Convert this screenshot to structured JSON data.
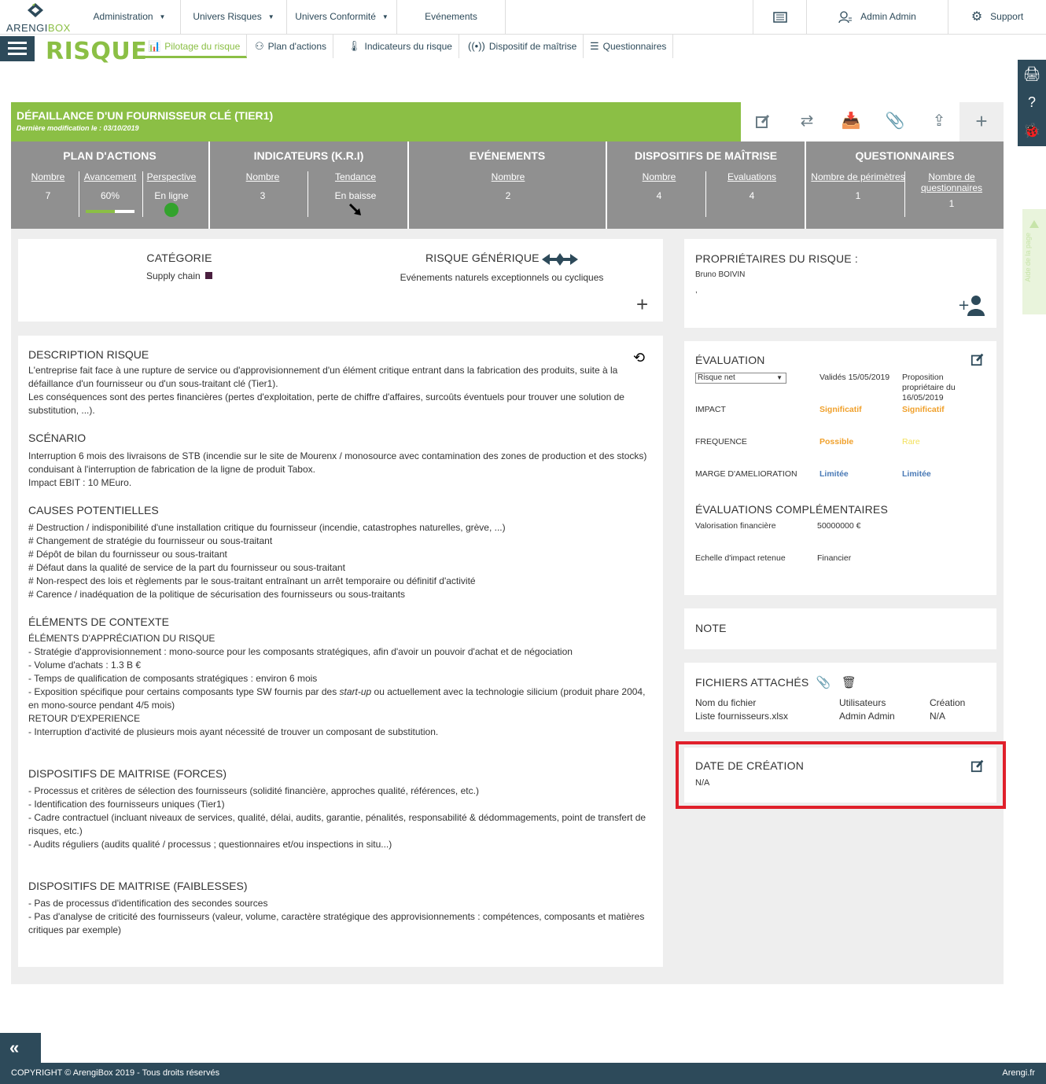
{
  "app": {
    "logo_text_a": "ARENGI",
    "logo_text_b": "BOX",
    "module_title": "RISQUE"
  },
  "topnav": {
    "items": [
      "Administration",
      "Univers Risques",
      "Univers Conformité",
      "Evénements"
    ],
    "user_label": "Admin Admin",
    "support_label": "Support"
  },
  "tabs": [
    "Pilotage du risque",
    "Plan d'actions",
    "Indicateurs du risque",
    "Dispositif de maîtrise",
    "Questionnaires"
  ],
  "risk": {
    "title": "DÉFAILLANCE D'UN FOURNISSEUR CLÉ (TIER1)",
    "last_modified": "Dernière modification le : 03/10/2019"
  },
  "kpis": {
    "plan": {
      "title": "PLAN D'ACTIONS",
      "nombre_label": "Nombre",
      "nombre": "7",
      "avancement_label": "Avancement",
      "avancement": "60%",
      "avancement_fraction": 0.6,
      "perspective_label": "Perspective",
      "perspective": "En ligne"
    },
    "indicateurs": {
      "title": "INDICATEURS (K.R.I)",
      "nombre_label": "Nombre",
      "nombre": "3",
      "tendance_label": "Tendance",
      "tendance": "En baisse"
    },
    "evenements": {
      "title": "EVÉNEMENTS",
      "nombre_label": "Nombre",
      "nombre": "2"
    },
    "dispositifs": {
      "title": "DISPOSITIFS DE MAÎTRISE",
      "nombre_label": "Nombre",
      "nombre": "4",
      "evaluations_label": "Evaluations",
      "evaluations": "4"
    },
    "questionnaires": {
      "title": "QUESTIONNAIRES",
      "perimetres_label": "Nombre de périmètres",
      "perimetres": "1",
      "questionnaires_label_1": "Nombre de",
      "questionnaires_label_2": "questionnaires",
      "questionnaires": "1"
    }
  },
  "category": {
    "label": "CATÉGORIE",
    "value": "Supply chain",
    "generic_label": "RISQUE GÉNÉRIQUE",
    "generic_value": "Evénements naturels exceptionnels ou cycliques"
  },
  "owners": {
    "label": "PROPRIÉTAIRES DU RISQUE :",
    "name": "Bruno BOIVIN",
    "extra": ","
  },
  "description": {
    "desc_h": "DESCRIPTION RISQUE",
    "desc_1": "L'entreprise fait face à une rupture de service ou d'approvisionnement d'un élément critique entrant dans la fabrication des produits, suite à la défaillance d'un fournisseur ou d'un sous-traitant clé (Tier1).",
    "desc_2": "Les conséquences sont des pertes financières (pertes d'exploitation, perte de chiffre d'affaires, surcoûts éventuels pour trouver une solution de substitution, ...).",
    "scen_h": "SCÉNARIO",
    "scen_1": "Interruption 6 mois des livraisons de STB (incendie sur le site de Mourenx / monosource avec contamination des zones de production et des stocks) conduisant à l'interruption de fabrication de la ligne de produit Tabox.",
    "scen_2": "Impact EBIT : 10 MEuro.",
    "causes_h": "CAUSES POTENTIELLES",
    "causes": [
      "# Destruction / indisponibilité d'une installation critique du fournisseur (incendie, catastrophes naturelles, grève, ...)",
      "# Changement de stratégie du fournisseur ou sous-traitant",
      "# Dépôt de bilan du fournisseur ou sous-traitant",
      "# Défaut dans la qualité de service de la part du fournisseur ou sous-traitant",
      "# Non-respect des lois et règlements par le sous-traitant entraînant un arrêt temporaire ou définitif d'activité",
      "# Carence / inadéquation de la politique de sécurisation des fournisseurs ou sous-traitants"
    ],
    "ctx_h": "ÉLÉMENTS DE CONTEXTE",
    "ctx_sub1": "ÉLÉMENTS D'APPRÉCIATION DU RISQUE",
    "ctx_1": "- Stratégie d'approvisionnement : mono-source pour les composants stratégiques, afin d'avoir un pouvoir d'achat et de négociation",
    "ctx_2": "- Volume d'achats : 1.3 B €",
    "ctx_3": "- Temps de qualification de composants stratégiques : environ 6 mois",
    "ctx_4a": "- Exposition spécifique pour certains composants type SW fournis par des ",
    "ctx_4b": "start-up",
    "ctx_4c": " ou actuellement avec la technologie silicium (produit phare 2004, en mono-source pendant 4/5 mois)",
    "ctx_sub2": "RETOUR D'EXPERIENCE",
    "ctx_5": "- Interruption d'activité de plusieurs mois ayant nécessité de trouver un composant de substitution.",
    "forces_h": "DISPOSITIFS DE MAITRISE (FORCES)",
    "forces": [
      "- Processus et critères de sélection des fournisseurs (solidité financière, approches qualité, références, etc.)",
      "- Identification des fournisseurs uniques (Tier1)",
      "- Cadre contractuel (incluant niveaux de services, qualité, délai, audits, garantie, pénalités, responsabilité & dédommagements, point de transfert de risques, etc.)",
      "- Audits réguliers (audits qualité / processus ; questionnaires et/ou inspections in situ...)"
    ],
    "faib_h": "DISPOSITIFS DE MAITRISE (FAIBLESSES)",
    "faiblesses": [
      "- Pas de processus d'identification des secondes sources",
      "- Pas d'analyse de criticité des fournisseurs (valeur, volume, caractère stratégique des approvisionnements : compétences, composants et matières critiques par exemple)"
    ]
  },
  "evaluation": {
    "title": "ÉVALUATION",
    "select": "Risque net",
    "col1": "Validés 15/05/2019",
    "col2": "Proposition propriétaire du 16/05/2019",
    "rows": [
      {
        "label": "IMPACT",
        "v1": "Significatif",
        "v2": "Significatif"
      },
      {
        "label": "FREQUENCE",
        "v1": "Possible",
        "v2": "Rare"
      },
      {
        "label": "MARGE D'AMELIORATION",
        "v1": "Limitée",
        "v2": "Limitée"
      }
    ],
    "comp_title": "ÉVALUATIONS COMPLÉMENTAIRES",
    "comp": [
      {
        "label": "Valorisation financière",
        "value": "50000000 €"
      },
      {
        "label": "Echelle d'impact retenue",
        "value": "Financier"
      }
    ]
  },
  "note": {
    "title": "NOTE"
  },
  "files": {
    "title": "FICHIERS ATTACHÉS",
    "headers": [
      "Nom du fichier",
      "Utilisateurs",
      "Création"
    ],
    "rows": [
      [
        "Liste fournisseurs.xlsx",
        "Admin Admin",
        "N/A"
      ]
    ]
  },
  "creation": {
    "title": "DATE DE CRÉATION",
    "value": "N/A"
  },
  "help_tab": "Aide de la page",
  "footer": {
    "copyright": "COPYRIGHT © ArengiBox 2019 - Tous droits réservés",
    "site": "Arengi.fr"
  },
  "colors": {
    "brand_green": "#8bbf45",
    "nav_dark": "#2d4a5a",
    "kpi_grey": "#909090",
    "highlight_red": "#e0202b"
  }
}
